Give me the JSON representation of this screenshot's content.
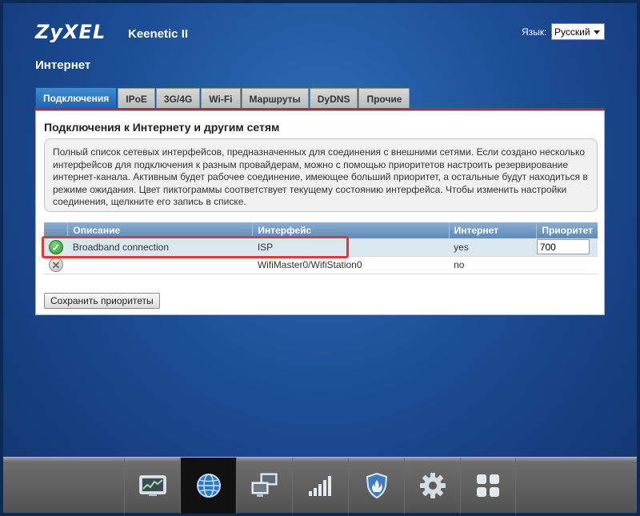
{
  "header": {
    "brand": "ZyXEL",
    "model": "Keenetic II",
    "language_label": "Язык:",
    "language_value": "Русский"
  },
  "page_title": "Интернет",
  "tabs": [
    {
      "label": "Подключения",
      "active": true
    },
    {
      "label": "IPoE",
      "active": false
    },
    {
      "label": "3G/4G",
      "active": false
    },
    {
      "label": "Wi-Fi",
      "active": false
    },
    {
      "label": "Маршруты",
      "active": false
    },
    {
      "label": "DyDNS",
      "active": false
    },
    {
      "label": "Прочие",
      "active": false
    }
  ],
  "panel": {
    "title": "Подключения к Интернету и другим сетям",
    "description": "Полный список сетевых интерфейсов, предназначенных для соединения с внешними сетями. Если создано несколько интерфейсов для подключения к разным провайдерам, можно с помощью приоритетов настроить резервирование интернет-канала. Активным будет рабочее соединение, имеющее больший приоритет, а остальные будут находиться в режиме ожидания. Цвет пиктограммы соответствует текущему состоянию интерфейса. Чтобы изменить настройки соединения, щелкните его запись в списке."
  },
  "table": {
    "columns": [
      "",
      "Описание",
      "Интерфейс",
      "Интернет",
      "Приоритет"
    ],
    "rows": [
      {
        "status": "ok",
        "status_icon": "check-icon",
        "description": "Broadband connection",
        "interface": "ISP",
        "internet": "yes",
        "priority": "700"
      },
      {
        "status": "off",
        "status_icon": "cross-icon",
        "description": "",
        "interface": "WifiMaster0/WifiStation0",
        "internet": "no",
        "priority": ""
      }
    ]
  },
  "save_button_label": "Сохранить приоритеты",
  "dock": [
    {
      "icon": "monitor-chart-icon",
      "active": false
    },
    {
      "icon": "globe-icon",
      "active": true
    },
    {
      "icon": "network-computers-icon",
      "active": false
    },
    {
      "icon": "signal-bars-icon",
      "active": false
    },
    {
      "icon": "shield-icon",
      "active": false
    },
    {
      "icon": "gear-icon",
      "active": false
    },
    {
      "icon": "apps-grid-icon",
      "active": false
    }
  ],
  "colors": {
    "accent_red": "#c62828",
    "tab_active": "#2a72be",
    "highlight": "#e53935"
  }
}
